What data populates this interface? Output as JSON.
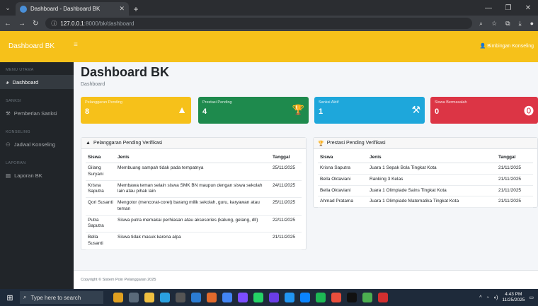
{
  "browser": {
    "tab_title": "Dashboard - Dashboard BK",
    "url_host": "127.0.0.1",
    "url_path": ":8000/bk/dashboard"
  },
  "navbar": {
    "brand": "Dashboard BK",
    "user": "Bimbingan Konseling"
  },
  "sidebar": {
    "sections": [
      {
        "heading": "MENU UTAMA",
        "items": [
          {
            "label": "Dashboard",
            "icon": "dashboard-icon"
          }
        ]
      },
      {
        "heading": "SANKSI",
        "items": [
          {
            "label": "Pemberian Sanksi",
            "icon": "gavel-icon"
          }
        ]
      },
      {
        "heading": "KONSELING",
        "items": [
          {
            "label": "Jadwal Konseling",
            "icon": "users-icon"
          }
        ]
      },
      {
        "heading": "LAPORAN",
        "items": [
          {
            "label": "Laporan BK",
            "icon": "file-icon"
          }
        ]
      }
    ]
  },
  "main": {
    "title": "Dashboard BK",
    "breadcrumb": "Dashboard"
  },
  "stats": [
    {
      "label": "Pelanggaran Pending",
      "value": "8",
      "icon": "warning-icon",
      "color": "#f6c11a"
    },
    {
      "label": "Prestasi Pending",
      "value": "4",
      "icon": "trophy-icon",
      "color": "#1e8a4d"
    },
    {
      "label": "Sanksi Aktif",
      "value": "1",
      "icon": "gavel-icon",
      "color": "#1ea7db"
    },
    {
      "label": "Siswa Bermasalah",
      "value": "0",
      "icon": "exclamation-icon",
      "color": "#dc3545"
    }
  ],
  "pelanggaran": {
    "title": "Pelanggaran Pending Verifikasi",
    "headers": [
      "Siswa",
      "Jenis",
      "Tanggal"
    ],
    "rows": [
      [
        "Gilang Suryani",
        "Membuang sampah tidak pada tempatnya",
        "25/11/2025"
      ],
      [
        "Krisna Saputra",
        "Membawa teman selain siswa SMK BN maupun dengan siswa sekolah lain atau pihak lain",
        "24/11/2025"
      ],
      [
        "Qori Susanti",
        "Mengotor (mencorat-coret) barang milik sekolah, guru, karyawan atau teman",
        "25/11/2025"
      ],
      [
        "Putra Saputra",
        "Siswa putra memakai perhiasan atau aksesories (kalung, gelang, dll)",
        "22/11/2025"
      ],
      [
        "Bella Susanti",
        "Siswa tidak masuk karena alpa",
        "21/11/2025"
      ]
    ]
  },
  "prestasi": {
    "title": "Prestasi Pending Verifikasi",
    "headers": [
      "Siswa",
      "Jenis",
      "Tanggal"
    ],
    "rows": [
      [
        "Krisna Saputra",
        "Juara 1 Sepak Bola Tingkat Kota",
        "21/11/2025"
      ],
      [
        "Bella Oktaviani",
        "Ranking 3 Kelas",
        "21/11/2025"
      ],
      [
        "Bella Oktaviani",
        "Juara 1 Olimpiade Sains Tingkat Kota",
        "21/11/2025"
      ],
      [
        "Ahmad Pratama",
        "Juara 1 Olimpiade Matematika Tingkat Kota",
        "21/11/2025"
      ]
    ]
  },
  "footer": {
    "text": "Copyright © Sistem Poin Pelanggaran 2025"
  },
  "taskbar": {
    "search_placeholder": "Type here to search",
    "time": "4:43 PM",
    "date": "11/25/2025"
  }
}
